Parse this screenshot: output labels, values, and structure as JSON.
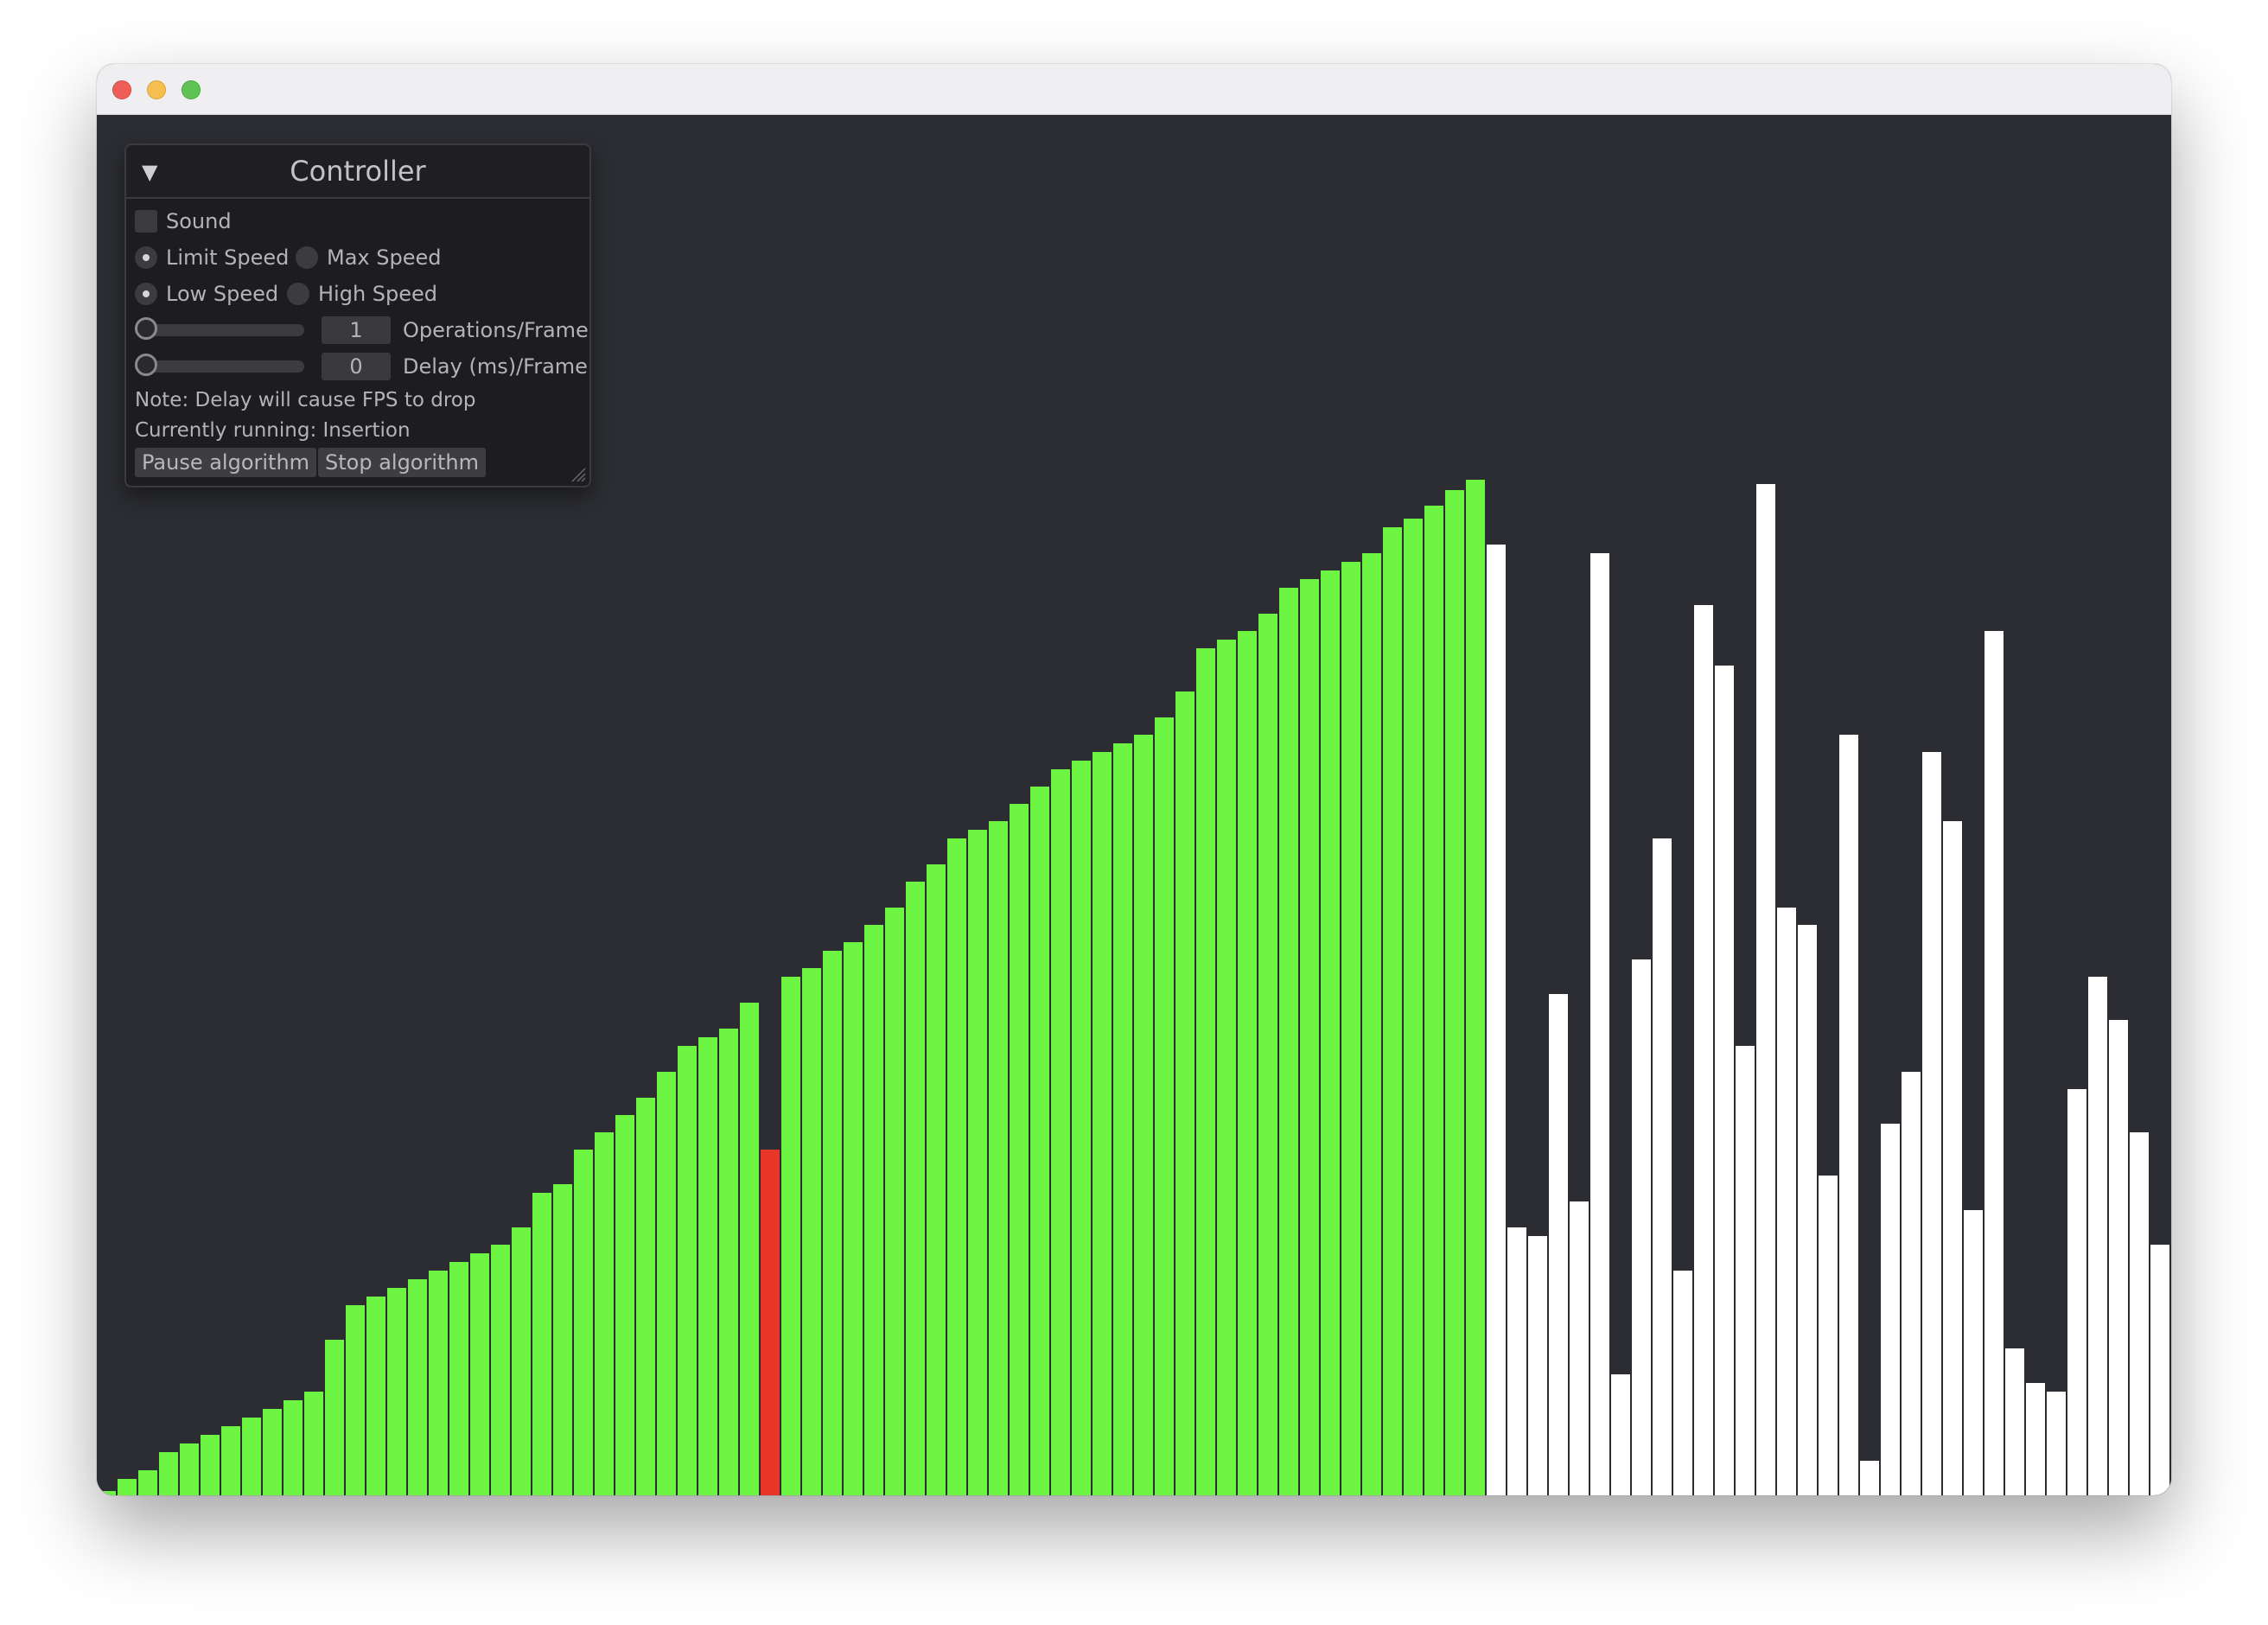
{
  "controller": {
    "title": "Controller",
    "sound_label": "Sound",
    "sound_checked": false,
    "speed_mode": {
      "options": [
        "Limit Speed",
        "Max Speed"
      ],
      "selected": "Limit Speed"
    },
    "speed_level": {
      "options": [
        "Low Speed",
        "High Speed"
      ],
      "selected": "Low Speed"
    },
    "operations_per_frame": {
      "value": "1",
      "label": "Operations/Frame"
    },
    "delay_per_frame": {
      "value": "0",
      "label": "Delay (ms)/Frame"
    },
    "note": "Note: Delay will cause FPS to drop",
    "status": "Currently running: Insertion",
    "pause_label": "Pause algorithm",
    "stop_label": "Stop algorithm"
  },
  "visualization": {
    "colors": {
      "sorted": "#6ef542",
      "active": "#e8352a",
      "unsorted": "#ffffff",
      "background": "#2c2d32"
    },
    "active_index": 32,
    "sorted_count": 67,
    "values": [
      5,
      19,
      29,
      50,
      60,
      70,
      80,
      90,
      100,
      110,
      120,
      180,
      220,
      230,
      240,
      250,
      260,
      270,
      280,
      290,
      310,
      350,
      360,
      400,
      420,
      440,
      460,
      490,
      520,
      530,
      540,
      570,
      400,
      600,
      610,
      630,
      640,
      660,
      680,
      710,
      730,
      760,
      770,
      780,
      800,
      820,
      840,
      850,
      860,
      870,
      880,
      900,
      930,
      980,
      990,
      1000,
      1020,
      1050,
      1060,
      1070,
      1080,
      1090,
      1120,
      1130,
      1145,
      1163,
      1175,
      1100,
      310,
      300,
      580,
      340,
      1090,
      140,
      620,
      760,
      260,
      1030,
      960,
      520,
      1170,
      680,
      660,
      370,
      880,
      40,
      430,
      490,
      860,
      780,
      330,
      1000,
      170,
      130,
      120,
      470,
      600,
      550,
      420,
      290
    ]
  }
}
